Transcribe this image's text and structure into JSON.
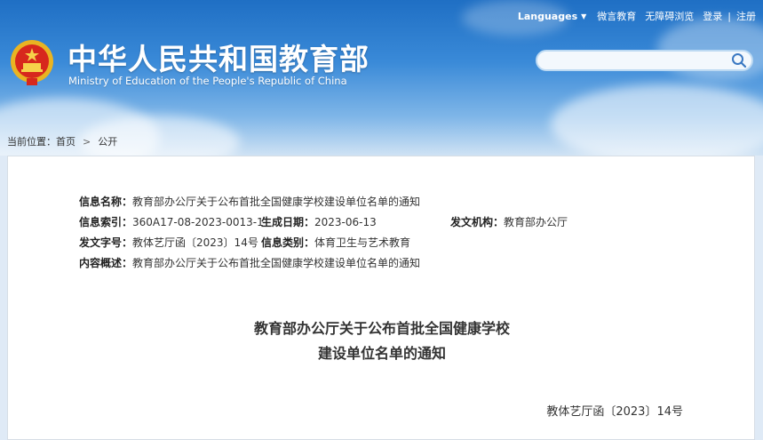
{
  "header": {
    "site_title_cn": "中华人民共和国教育部",
    "site_title_en": "Ministry of Education of the People's Republic of China"
  },
  "topnav": {
    "languages": "Languages",
    "weibo": "微言教育",
    "accessibility": "无障碍浏览",
    "login": "登录",
    "separator": "|",
    "register": "注册"
  },
  "search": {
    "placeholder": ""
  },
  "breadcrumb": {
    "prefix": "当前位置：",
    "home": "首页",
    "current": "公开"
  },
  "meta": {
    "name_label": "信息名称：",
    "name_value": "教育部办公厅关于公布首批全国健康学校建设单位名单的通知",
    "index_label": "信息索引：",
    "index_value": "360A17-08-2023-0013-1",
    "date_label": "生成日期：",
    "date_value": "2023-06-13",
    "org_label": "发文机构：",
    "org_value": "教育部办公厅",
    "docno_label": "发文字号：",
    "docno_value": "教体艺厅函〔2023〕14号",
    "type_label": "信息类别：",
    "type_value": "体育卫生与艺术教育",
    "summary_label": "内容概述：",
    "summary_value": "教育部办公厅关于公布首批全国健康学校建设单位名单的通知"
  },
  "document": {
    "title_line1": "教育部办公厅关于公布首批全国健康学校",
    "title_line2": "建设单位名单的通知",
    "number": "教体艺厅函〔2023〕14号"
  }
}
